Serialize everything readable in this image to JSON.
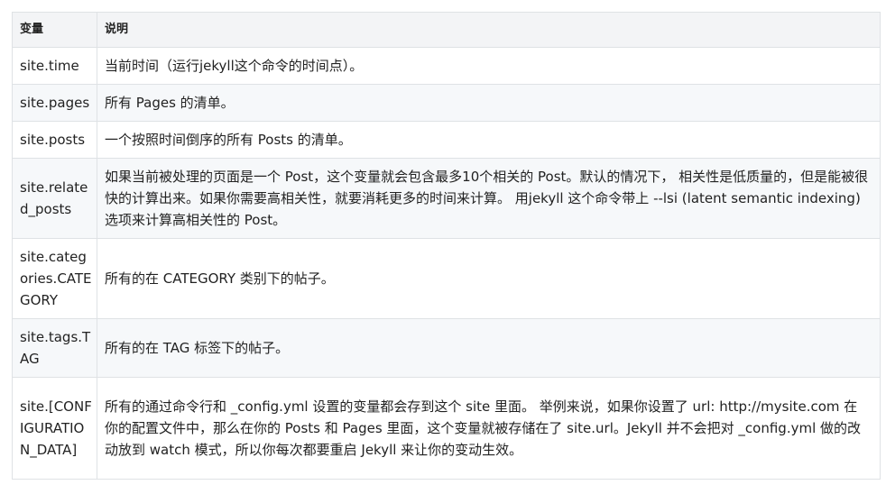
{
  "table": {
    "headers": [
      "变量",
      "说明"
    ],
    "rows": [
      {
        "name": "site.time",
        "desc": "当前时间（运行jekyll这个命令的时间点）。"
      },
      {
        "name": "site.pages",
        "desc": "所有 Pages 的清单。"
      },
      {
        "name": "site.posts",
        "desc": "一个按照时间倒序的所有 Posts 的清单。"
      },
      {
        "name": "site.related_posts",
        "desc": "如果当前被处理的页面是一个 Post，这个变量就会包含最多10个相关的 Post。默认的情况下， 相关性是低质量的，但是能被很快的计算出来。如果你需要高相关性，就要消耗更多的时间来计算。 用jekyll 这个命令带上 --lsi (latent semantic indexing) 选项来计算高相关性的 Post。"
      },
      {
        "name": "site.categories.CATEGORY",
        "desc": "所有的在 CATEGORY 类别下的帖子。"
      },
      {
        "name": "site.tags.TAG",
        "desc": "所有的在 TAG 标签下的帖子。"
      },
      {
        "name": "site.[CONFIGURATION_DATA]",
        "desc": "所有的通过命令行和 _config.yml 设置的变量都会存到这个 site 里面。 举例来说，如果你设置了 url: http://mysite.com 在你的配置文件中，那么在你的 Posts 和 Pages 里面，这个变量就被存储在了 site.url。Jekyll 并不会把对 _config.yml 做的改动放到 watch 模式，所以你每次都要重启 Jekyll 来让你的变动生效。"
      }
    ]
  }
}
